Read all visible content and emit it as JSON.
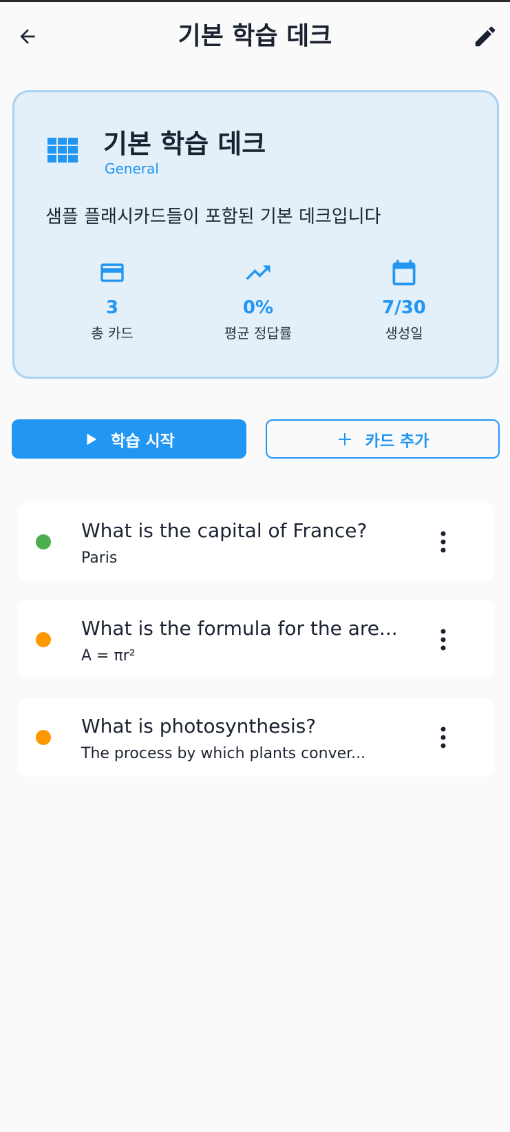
{
  "appbar": {
    "title": "기본 학습 데크"
  },
  "deck": {
    "name": "기본 학습 데크",
    "category": "General",
    "description": "샘플 플래시카드들이 포함된 기본 데크입니다",
    "stats": [
      {
        "icon": "credit-card-icon",
        "value": "3",
        "label": "총 카드"
      },
      {
        "icon": "trending-up-icon",
        "value": "0%",
        "label": "평균 정답률"
      },
      {
        "icon": "calendar-icon",
        "value": "7/30",
        "label": "생성일"
      }
    ]
  },
  "actions": {
    "study_label": "학습 시작",
    "add_label": "카드 추가"
  },
  "cards": [
    {
      "question": "What is the capital of France?",
      "answer": "Paris",
      "status_color": "#4caf50"
    },
    {
      "question": "What is the formula for the are...",
      "answer": "A = πr²",
      "status_color": "#ff9800"
    },
    {
      "question": "What is photosynthesis?",
      "answer": "The process by which plants conver...",
      "status_color": "#ff9800"
    }
  ],
  "colors": {
    "accent": "#2196f3",
    "card_bg": "#e3eff9",
    "card_border": "#a8d2f3",
    "mastered": "#4caf50",
    "learning": "#ff9800"
  }
}
